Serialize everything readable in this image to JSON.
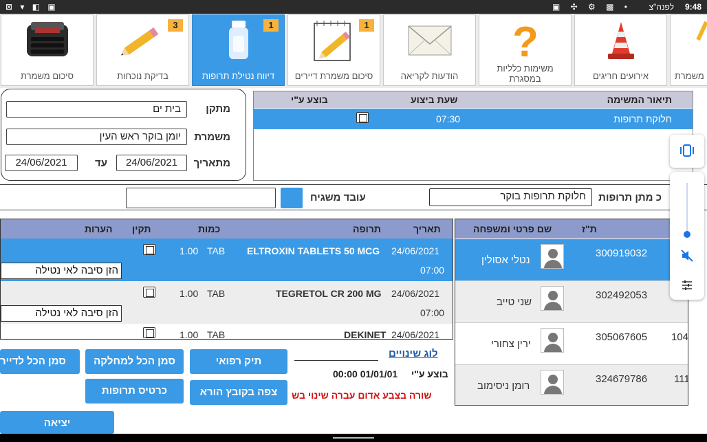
{
  "status_bar": {
    "time": "9:48",
    "label": "לפנה\"צ",
    "left_icons": "⊠ ▾ ◧ ▣",
    "right_icons": "▣ ✣ ⚙ ▩ •"
  },
  "toolbar": {
    "tiles": [
      {
        "label": "סיכום משמרת",
        "badge": "",
        "icon": "typewriter-icon"
      },
      {
        "label": "בדיקת נוכחות",
        "badge": "3",
        "icon": "pencil-icon"
      },
      {
        "label": "דיווח נטילת תרופות",
        "badge": "1",
        "icon": "pill-bottle-icon",
        "active": true
      },
      {
        "label": "סיכום משמרת דיירים",
        "badge": "1",
        "icon": "notepad-pencil-icon"
      },
      {
        "label": "הודעות לקריאה",
        "badge": "",
        "icon": "envelope-icon"
      },
      {
        "label": "משימות כלליות במסגרת",
        "badge": "",
        "icon": "question-mark-icon"
      },
      {
        "label": "אירועים חריגים",
        "badge": "",
        "icon": "traffic-cone-icon"
      },
      {
        "label": "משמרת",
        "badge": "",
        "icon": "partial-icon"
      }
    ]
  },
  "filter": {
    "facility_label": "מתקן",
    "facility_value": "בית ים",
    "shift_label": "משמרת",
    "shift_value": "יומן בוקר ראש העין",
    "from_label": "מתאריך",
    "from_value": "24/06/2021",
    "to_label": "עד",
    "to_value": "24/06/2021"
  },
  "tasks": {
    "headers": {
      "description": "תיאור המשימה",
      "time": "שעת ביצוע",
      "by": "בוצע ע\"י"
    },
    "rows": [
      {
        "description": "חלוקת תרופות",
        "time": "07:30"
      }
    ]
  },
  "meds_given": {
    "label": "כ מתן תרופות",
    "value": "חלוקת תרופות בוקר",
    "supervisor_label": "עובד משגיח",
    "supervisor_value": ""
  },
  "drugs": {
    "headers": {
      "date": "תאריך",
      "drug": "תרופה",
      "qty": "כמות",
      "valid": "תקין",
      "notes": "הערות"
    },
    "rows": [
      {
        "date": "24/06/2021",
        "time": "07:00",
        "drug": "ELTROXIN TABLETS 50 MCG",
        "unit": "TAB",
        "qty": "1.00",
        "reason": "הזן סיבה לאי נטילה"
      },
      {
        "date": "24/06/2021",
        "time": "07:00",
        "drug": "TEGRETOL CR 200 MG",
        "unit": "TAB",
        "qty": "1.00",
        "reason": "הזן סיבה לאי נטילה"
      },
      {
        "date": "24/06/2021",
        "time": "",
        "drug": "DEKINET",
        "unit": "TAB",
        "qty": "1.00",
        "reason": ""
      }
    ]
  },
  "patients": {
    "headers": {
      "id": "ת\"ז",
      "name": "שם פרטי ומשפחה"
    },
    "rows": [
      {
        "room": "",
        "id": "300919032",
        "name": "נטלי אסולין"
      },
      {
        "room": "",
        "id": "302492053",
        "name": "שני טייב"
      },
      {
        "room": "104",
        "id": "305067605",
        "name": "ירין צחורי"
      },
      {
        "room": "111",
        "id": "324679786",
        "name": "רומן ניסימוב"
      }
    ]
  },
  "footer": {
    "log_link": "לוג שינויים",
    "done_by_label": "בוצע ע\"י",
    "done_by_value": "00:00 01/01/01",
    "note": "שורה בצבע אדום עברה שינוי בש",
    "buttons": {
      "medical_file": "תיק רפואי",
      "view_file": "צפה בקובץ הורא",
      "mark_all_dept": "סמן הכל למחלקה",
      "med_card": "כרטיס תרופות",
      "mark_all_resident": "סמן הכל לדייר",
      "exit": "יציאה"
    }
  },
  "colors": {
    "accent": "#3a9ae6",
    "header": "#8c9bcc",
    "badge": "#f6b23b",
    "note": "#d01414"
  }
}
